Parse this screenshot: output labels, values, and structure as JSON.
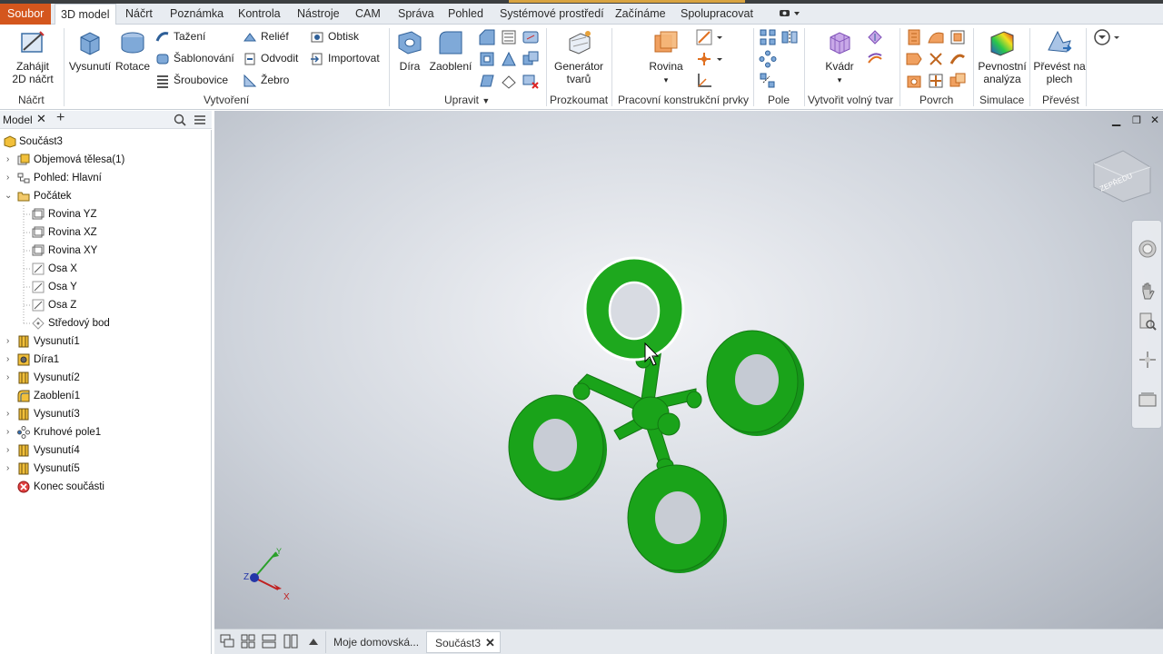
{
  "menu_tabs": [
    "Soubor",
    "3D model",
    "Náčrt",
    "Poznámka",
    "Kontrola",
    "Nástroje",
    "CAM",
    "Správa",
    "Pohled",
    "Systémové prostředí",
    "Začínáme",
    "Spolupracovat"
  ],
  "ribbon": {
    "sketch": {
      "start_sketch_l1": "Zahájit",
      "start_sketch_l2": "2D náčrt",
      "group": "Náčrt"
    },
    "create": {
      "extrude": "Vysunutí",
      "revolve": "Rotace",
      "sweep": "Tažení",
      "loft": "Šablonování",
      "coil": "Šroubovice",
      "emboss": "Reliéf",
      "derive": "Odvodit",
      "rib": "Žebro",
      "decal": "Obtisk",
      "import": "Importovat",
      "group": "Vytvoření"
    },
    "modify": {
      "hole": "Díra",
      "fillet": "Zaoblení",
      "group": "Upravit"
    },
    "explore": {
      "shape_gen_l1": "Generátor",
      "shape_gen_l2": "tvarů",
      "group": "Prozkoumat"
    },
    "work_features": {
      "plane": "Rovina",
      "group": "Pracovní konstrukční prvky"
    },
    "pattern": {
      "group": "Pole"
    },
    "freeform": {
      "box": "Kvádr",
      "group": "Vytvořit volný tvar"
    },
    "surface": {
      "group": "Povrch"
    },
    "simulation": {
      "stress_l1": "Pevnostní",
      "stress_l2": "analýza",
      "group": "Simulace"
    },
    "convert": {
      "to_sheet_l1": "Převést na",
      "to_sheet_l2": "plech",
      "group": "Převést"
    }
  },
  "panel": {
    "tab": "Model"
  },
  "tree": [
    {
      "label": "Součást3",
      "icon": "part-icon"
    },
    {
      "label": "Objemová tělesa(1)",
      "icon": "solid-bodies-icon"
    },
    {
      "label": "Pohled: Hlavní",
      "icon": "view-rep-icon"
    },
    {
      "label": "Počátek",
      "icon": "folder-icon"
    },
    {
      "label": "Rovina YZ",
      "icon": "plane-icon"
    },
    {
      "label": "Rovina XZ",
      "icon": "plane-icon"
    },
    {
      "label": "Rovina XY",
      "icon": "plane-icon"
    },
    {
      "label": "Osa X",
      "icon": "axis-icon"
    },
    {
      "label": "Osa Y",
      "icon": "axis-icon"
    },
    {
      "label": "Osa Z",
      "icon": "axis-icon"
    },
    {
      "label": "Středový bod",
      "icon": "point-icon"
    },
    {
      "label": "Vysunutí1",
      "icon": "extrude-icon"
    },
    {
      "label": "Díra1",
      "icon": "hole-icon"
    },
    {
      "label": "Vysunutí2",
      "icon": "extrude-icon"
    },
    {
      "label": "Zaoblení1",
      "icon": "fillet-icon"
    },
    {
      "label": "Vysunutí3",
      "icon": "extrude-icon"
    },
    {
      "label": "Kruhové pole1",
      "icon": "circular-pattern-icon"
    },
    {
      "label": "Vysunutí4",
      "icon": "extrude-icon"
    },
    {
      "label": "Vysunutí5",
      "icon": "extrude-icon"
    },
    {
      "label": "Konec součásti",
      "icon": "end-of-part-icon"
    }
  ],
  "viewcube": {
    "face": "ZEPŘEDU"
  },
  "triad": {
    "x": "X",
    "y": "Y",
    "z": "Z"
  },
  "bottom_tabs": {
    "home": "Moje domovská...",
    "doc": "Součást3"
  },
  "colors": {
    "file_tab": "#d4561d",
    "model_green": "#1aa31a",
    "accent_blue": "#2e6fb7"
  }
}
